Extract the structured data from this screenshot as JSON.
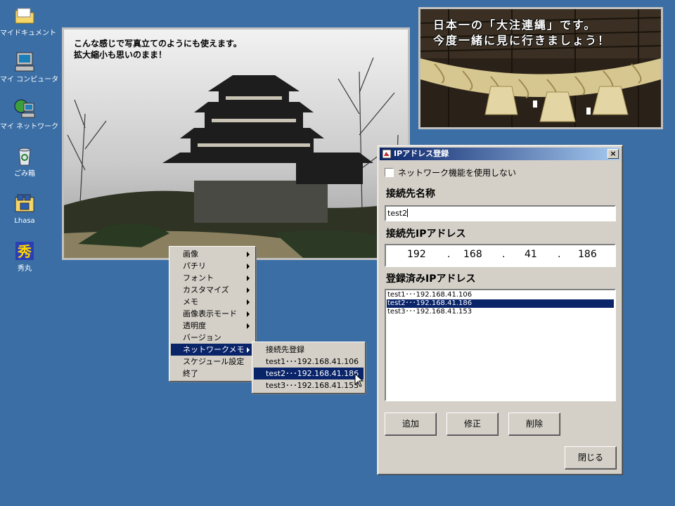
{
  "desktop": {
    "icons": [
      {
        "label": "マイドキュメント",
        "icon": "folder-icon"
      },
      {
        "label": "マイ コンピュータ",
        "icon": "computer-icon"
      },
      {
        "label": "マイ ネットワーク",
        "icon": "network-icon"
      },
      {
        "label": "ごみ箱",
        "icon": "recycle-bin-icon"
      },
      {
        "label": "Lhasa",
        "icon": "archive-icon"
      },
      {
        "label": "秀丸",
        "icon": "editor-icon"
      }
    ],
    "background_color": "#3a6ea5"
  },
  "castle_photo": {
    "caption_line1": "こんな感じで写真立てのようにも使えます。",
    "caption_line2": "拡大縮小も思いのまま！"
  },
  "rope_photo": {
    "caption_line1": "日本一の「大注連縄」です。",
    "caption_line2": "今度一緒に見に行きましょう！"
  },
  "context_menu": {
    "items": [
      {
        "label": "画像",
        "submenu": true
      },
      {
        "label": "パチリ",
        "submenu": true
      },
      {
        "label": "フォント",
        "submenu": true
      },
      {
        "label": "カスタマイズ",
        "submenu": true
      },
      {
        "label": "メモ",
        "submenu": true
      },
      {
        "label": "画像表示モード",
        "submenu": true
      },
      {
        "label": "透明度",
        "submenu": true
      },
      {
        "label": "バージョン",
        "submenu": false
      },
      {
        "label": "ネットワークメモ",
        "submenu": true,
        "selected": true
      },
      {
        "label": "スケジュール設定",
        "submenu": false
      },
      {
        "label": "終了",
        "submenu": false
      }
    ]
  },
  "network_submenu": {
    "items": [
      {
        "label": "接続先登録"
      },
      {
        "label": "test1･･･192.168.41.106"
      },
      {
        "label": "test2･･･192.168.41.186",
        "selected": true
      },
      {
        "label": "test3･･･192.168.41.153"
      }
    ]
  },
  "dialog": {
    "title": "IPアドレス登録",
    "close_label": "×",
    "disable_network_label": "ネットワーク機能を使用しない",
    "disable_network_checked": false,
    "name_label": "接続先名称",
    "name_value": "test2",
    "ip_label": "接続先IPアドレス",
    "ip_octets": [
      "192",
      "168",
      "41",
      "186"
    ],
    "ip_dot": ".",
    "list_label": "登録済みIPアドレス",
    "list_items": [
      "test1･･･192.168.41.106",
      "test2･･･192.168.41.186",
      "test3･･･192.168.41.153"
    ],
    "selected_index": 1,
    "add_label": "追加",
    "edit_label": "修正",
    "delete_label": "削除",
    "close_button_label": "閉じる"
  }
}
